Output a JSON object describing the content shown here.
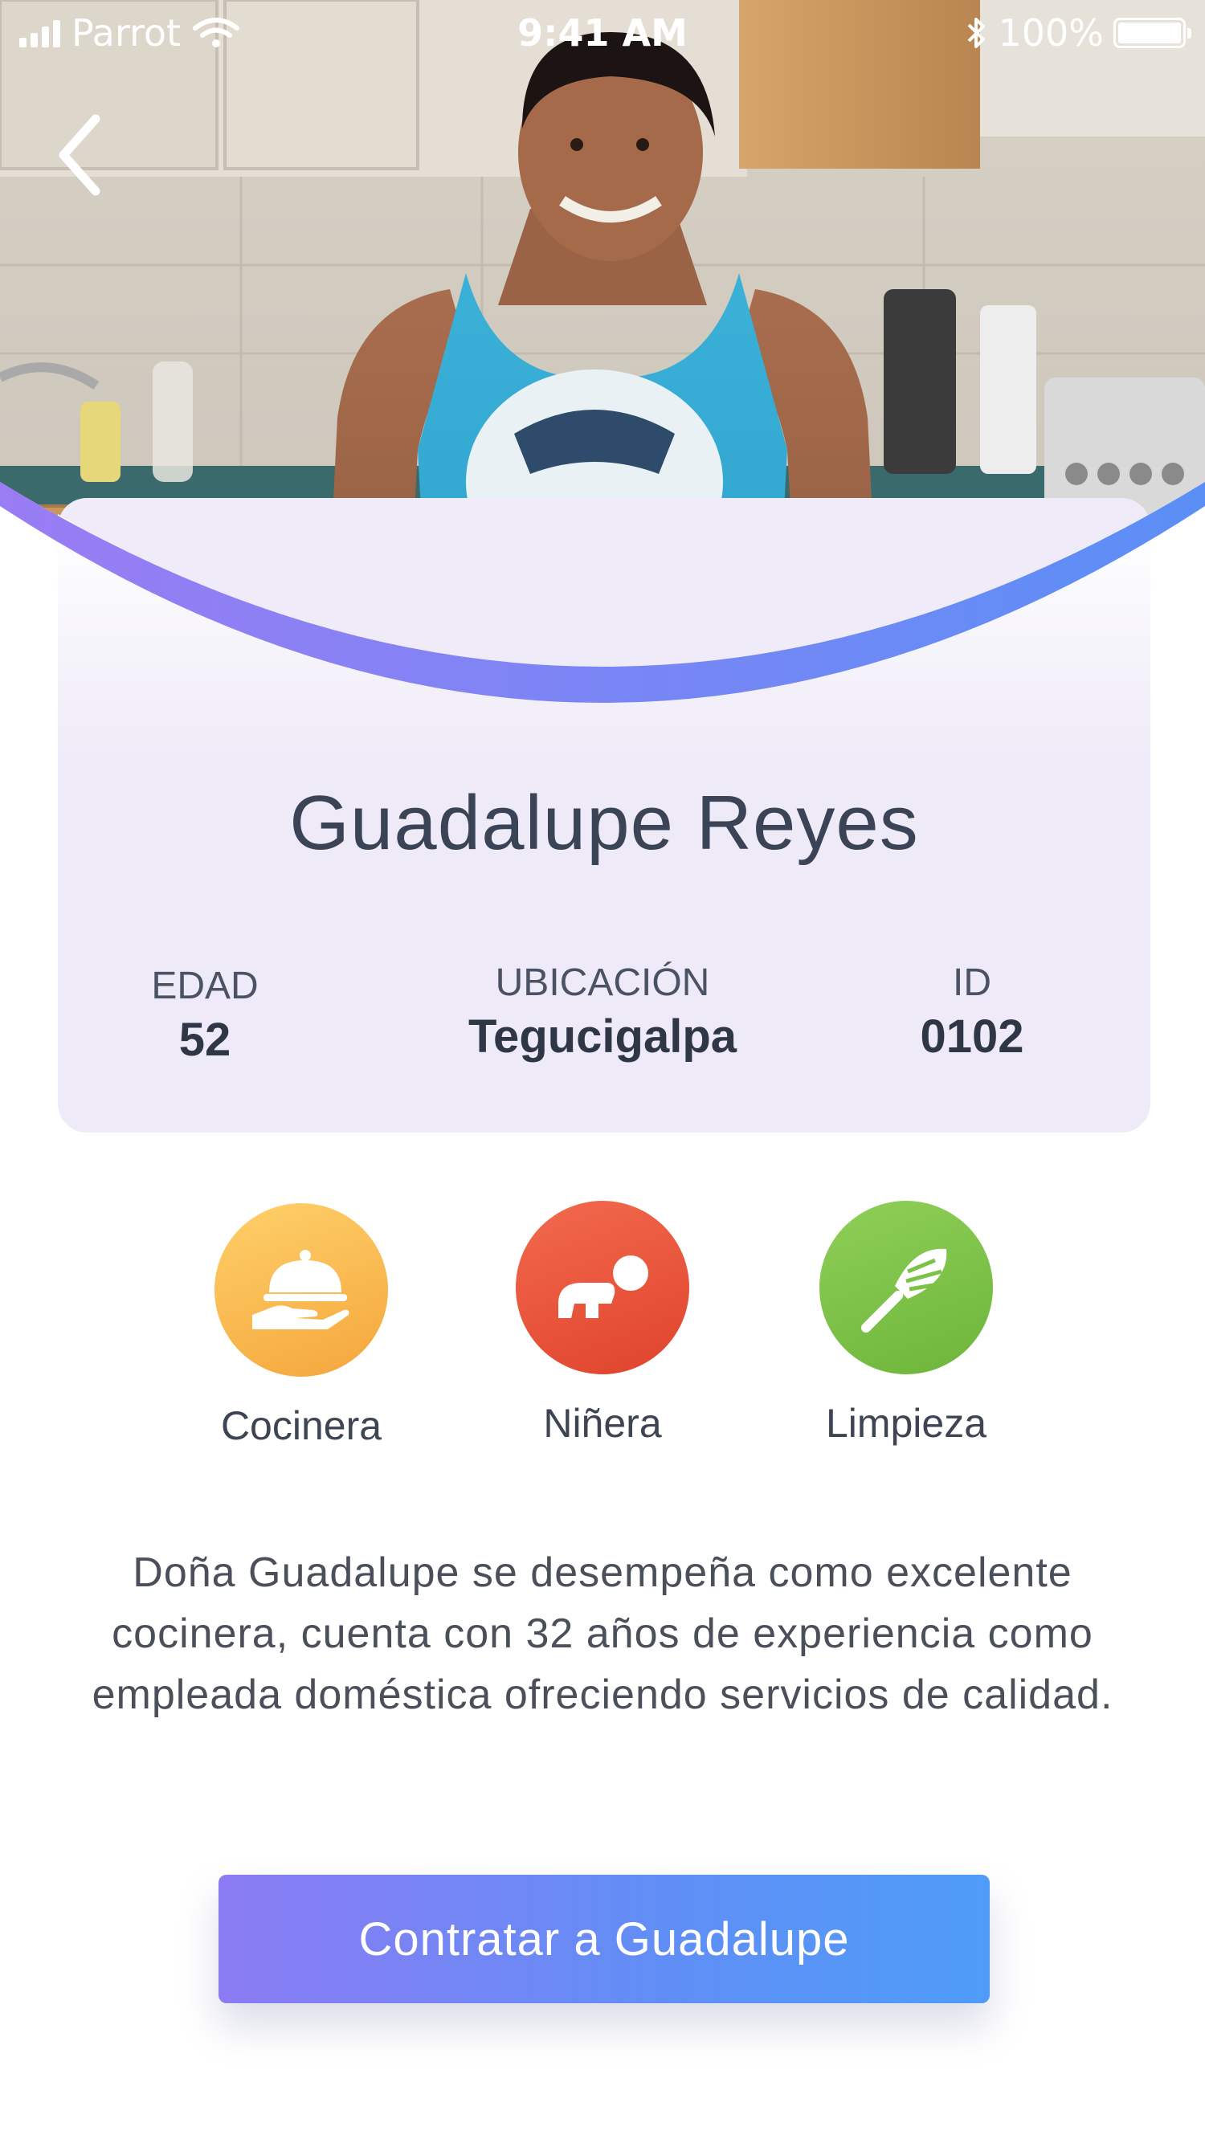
{
  "status_bar": {
    "carrier": "Parrot",
    "time": "9:41 AM",
    "battery": "100%"
  },
  "nav": {
    "back_icon": "chevron-left-icon"
  },
  "profile": {
    "name": "Guadalupe Reyes",
    "stats": [
      {
        "label": "EDAD",
        "value": "52"
      },
      {
        "label": "UBICACIÓN",
        "value": "Tegucigalpa"
      },
      {
        "label": "ID",
        "value": "0102"
      }
    ]
  },
  "skills": [
    {
      "label": "Cocinera",
      "icon": "serving-cloche-icon",
      "color_from": "#ffd06a",
      "color_to": "#f4a63c"
    },
    {
      "label": "Niñera",
      "icon": "crawling-baby-icon",
      "color_from": "#f26a4f",
      "color_to": "#e0432c"
    },
    {
      "label": "Limpieza",
      "icon": "feather-duster-icon",
      "color_from": "#8fcf58",
      "color_to": "#6db53a"
    }
  ],
  "description": "Doña Guadalupe se desempeña como excelente cocinera, cuenta con 32 años de experiencia como empleada doméstica ofreciendo servicios de calidad.",
  "cta": {
    "label": "Contratar a Guadalupe"
  },
  "colors": {
    "accent_gradient_start": "#8b7bf3",
    "accent_gradient_end": "#4f9cf8",
    "card_background": "#efebf8",
    "title_text": "#3b4456"
  }
}
